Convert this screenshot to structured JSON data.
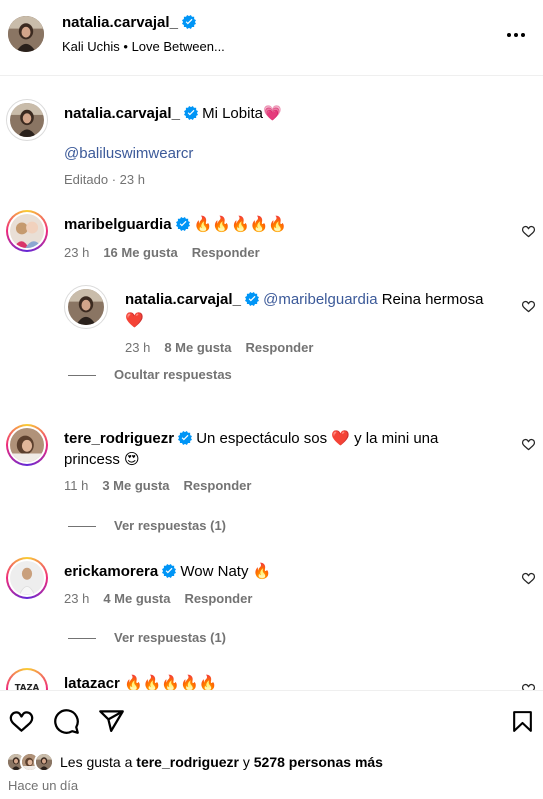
{
  "header": {
    "username": "natalia.carvajal_",
    "subtitle": "Kali Uchis • Love Between..."
  },
  "caption": {
    "username": "natalia.carvajal_",
    "text": "Mi Lobita💗",
    "mention": "@baliluswimwearcr",
    "meta": "Editado · 23 h"
  },
  "comments": [
    {
      "username": "maribelguardia",
      "text": "🔥🔥🔥🔥🔥",
      "time": "23 h",
      "likes": "16 Me gusta",
      "reply": "Responder",
      "replies": [
        {
          "username": "natalia.carvajal_",
          "mention": "@maribelguardia",
          "text": " Reina hermosa",
          "text2": "❤️",
          "time": "23 h",
          "likes": "8 Me gusta",
          "reply": "Responder"
        }
      ],
      "toggle": "Ocultar respuestas"
    },
    {
      "username": "tere_rodriguezr",
      "text": "Un espectáculo sos ❤️ y la mini una",
      "text2": "princess 😍",
      "time": "11 h",
      "likes": "3 Me gusta",
      "reply": "Responder",
      "toggle": "Ver respuestas (1)"
    },
    {
      "username": "erickamorera",
      "text": "Wow Naty 🔥",
      "time": "23 h",
      "likes": "4 Me gusta",
      "reply": "Responder",
      "toggle": "Ver respuestas (1)"
    },
    {
      "username": "latazacr",
      "text": "🔥🔥🔥🔥🔥"
    }
  ],
  "footer": {
    "likes_prefix": "Les gusta a ",
    "likes_user": "tere_rodriguezr",
    "likes_mid": " y ",
    "likes_count": "5278 personas más",
    "time_ago": "Hace un día"
  },
  "colors": {
    "verified": "#0095f6",
    "mention": "#3c5a99",
    "meta": "#737373"
  }
}
